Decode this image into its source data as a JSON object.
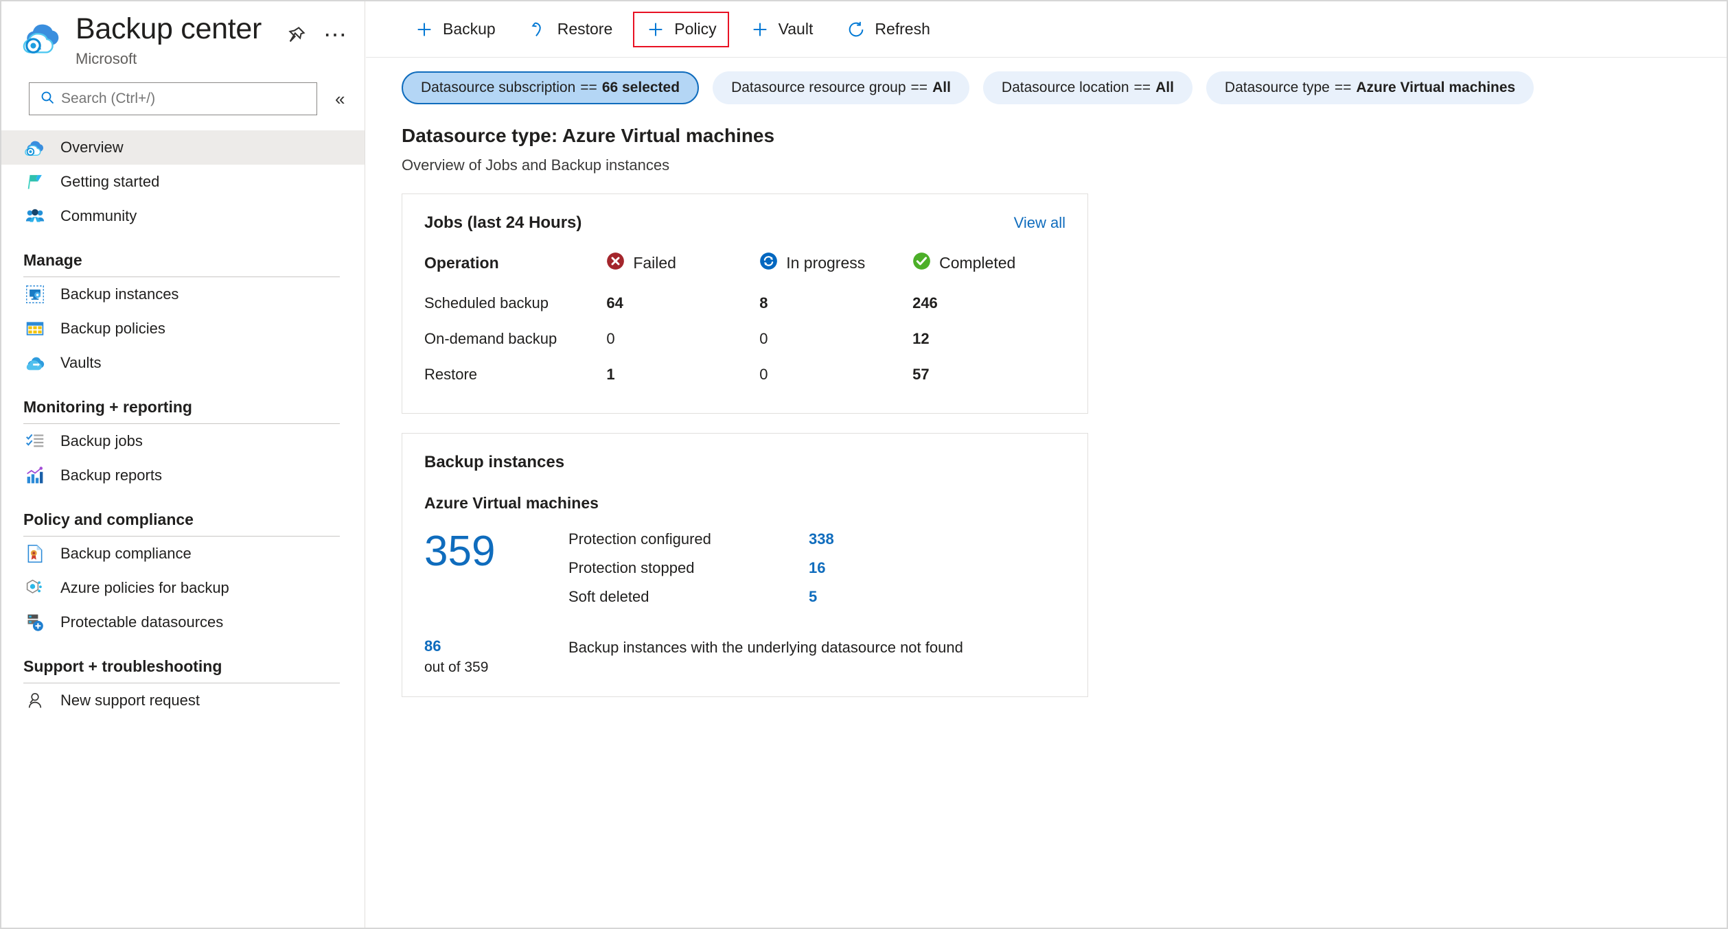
{
  "header": {
    "title": "Backup center",
    "subtitle": "Microsoft",
    "pin_icon": "pin-icon",
    "more_icon": "ellipsis-icon"
  },
  "search": {
    "placeholder": "Search (Ctrl+/)",
    "value": "",
    "icon": "search-icon",
    "collapse_label": "«"
  },
  "sidebar": {
    "top_items": [
      {
        "label": "Overview",
        "icon": "cloud-backup-icon",
        "selected": true
      },
      {
        "label": "Getting started",
        "icon": "flag-icon",
        "selected": false
      },
      {
        "label": "Community",
        "icon": "people-icon",
        "selected": false
      }
    ],
    "groups": [
      {
        "title": "Manage",
        "items": [
          {
            "label": "Backup instances",
            "icon": "backup-instance-icon"
          },
          {
            "label": "Backup policies",
            "icon": "policy-table-icon"
          },
          {
            "label": "Vaults",
            "icon": "vault-cloud-icon"
          }
        ]
      },
      {
        "title": "Monitoring + reporting",
        "items": [
          {
            "label": "Backup jobs",
            "icon": "checklist-icon"
          },
          {
            "label": "Backup reports",
            "icon": "bar-chart-icon"
          }
        ]
      },
      {
        "title": "Policy and compliance",
        "items": [
          {
            "label": "Backup compliance",
            "icon": "certificate-doc-icon"
          },
          {
            "label": "Azure policies for backup",
            "icon": "azure-policy-icon"
          },
          {
            "label": "Protectable datasources",
            "icon": "server-plus-icon"
          }
        ]
      },
      {
        "title": "Support + troubleshooting",
        "items": [
          {
            "label": "New support request",
            "icon": "person-support-icon"
          }
        ]
      }
    ]
  },
  "toolbar": {
    "buttons": [
      {
        "label": "Backup",
        "icon": "plus-icon",
        "highlighted": false
      },
      {
        "label": "Restore",
        "icon": "restore-arrow-icon",
        "highlighted": false
      },
      {
        "label": "Policy",
        "icon": "plus-icon",
        "highlighted": true
      },
      {
        "label": "Vault",
        "icon": "plus-icon",
        "highlighted": false
      },
      {
        "label": "Refresh",
        "icon": "refresh-icon",
        "highlighted": false
      }
    ],
    "highlight_color": "#e81123"
  },
  "filters": [
    {
      "label": "Datasource subscription",
      "op": "==",
      "value": "66 selected",
      "active": true
    },
    {
      "label": "Datasource resource group",
      "op": "==",
      "value": "All",
      "active": false
    },
    {
      "label": "Datasource location",
      "op": "==",
      "value": "All",
      "active": false
    },
    {
      "label": "Datasource type",
      "op": "==",
      "value": "Azure Virtual machines",
      "active": false
    }
  ],
  "main": {
    "title": "Datasource type: Azure Virtual machines",
    "subtitle": "Overview of Jobs and Backup instances"
  },
  "jobs_card": {
    "title": "Jobs (last 24 Hours)",
    "view_all": "View all",
    "columns": [
      "Operation",
      "Failed",
      "In progress",
      "Completed"
    ],
    "column_icons": [
      "",
      "failed-icon",
      "in-progress-icon",
      "completed-icon"
    ],
    "rows": [
      {
        "operation": "Scheduled backup",
        "failed": "64",
        "in_progress": "8",
        "completed": "246"
      },
      {
        "operation": "On-demand backup",
        "failed": "0",
        "in_progress": "0",
        "completed": "12"
      },
      {
        "operation": "Restore",
        "failed": "1",
        "in_progress": "0",
        "completed": "57"
      }
    ]
  },
  "instances_card": {
    "title": "Backup instances",
    "subtitle": "Azure Virtual machines",
    "total": "359",
    "rows": [
      {
        "label": "Protection configured",
        "value": "338"
      },
      {
        "label": "Protection stopped",
        "value": "16"
      },
      {
        "label": "Soft deleted",
        "value": "5"
      }
    ],
    "footer_count": "86",
    "footer_of": "out of 359",
    "footer_text": "Backup instances with the underlying datasource not found"
  },
  "colors": {
    "link": "#0f6cbd",
    "accent": "#0078d4",
    "failed": "#a4262c",
    "in_progress": "#0078d4",
    "completed": "#107c10",
    "selected_nav": "#edebe9",
    "pill_bg": "#e9f1fb",
    "pill_active_bg": "#b4d6f5"
  }
}
